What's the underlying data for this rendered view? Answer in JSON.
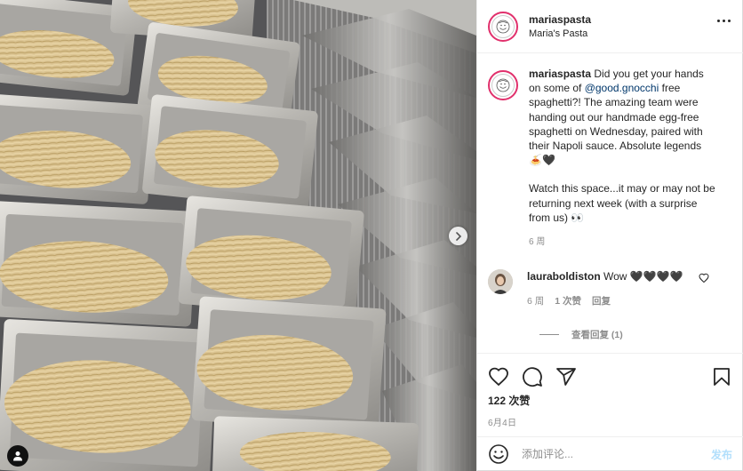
{
  "header": {
    "username": "mariaspasta",
    "location": "Maria's Pasta"
  },
  "caption": {
    "username": "mariaspasta",
    "text_before": "Did you get your hands on some of ",
    "mention": "@good.gnocchi",
    "text_after": " free spaghetti?! The amazing team were handing out our handmade egg-free spaghetti on Wednesday, paired with their Napoli sauce. Absolute legends 🍝🖤",
    "text_second": "Watch this space...it may or may not be returning next week (with a surprise from us) 👀",
    "time": "6 周"
  },
  "comment": {
    "username": "lauraboldiston",
    "text": "Wow 🖤🖤🖤🖤",
    "time": "6 周",
    "likes": "1 次赞",
    "reply": "回复",
    "view_replies": "查看回复 (1)"
  },
  "likes": "122 次赞",
  "date": "6月4日",
  "add_comment": {
    "placeholder": "添加评论...",
    "post_label": "发布"
  },
  "colors": {
    "accent": "#0095f6",
    "post_disabled": "#b2dffc",
    "mention": "#00376b",
    "secondary_text": "#8e8e8e",
    "story_ring": "#e1306c"
  },
  "icons": [
    "chevron-right-icon",
    "user-tag-icon",
    "more-options-icon",
    "heart-icon",
    "comment-icon",
    "share-icon",
    "bookmark-icon",
    "emoji-icon"
  ]
}
